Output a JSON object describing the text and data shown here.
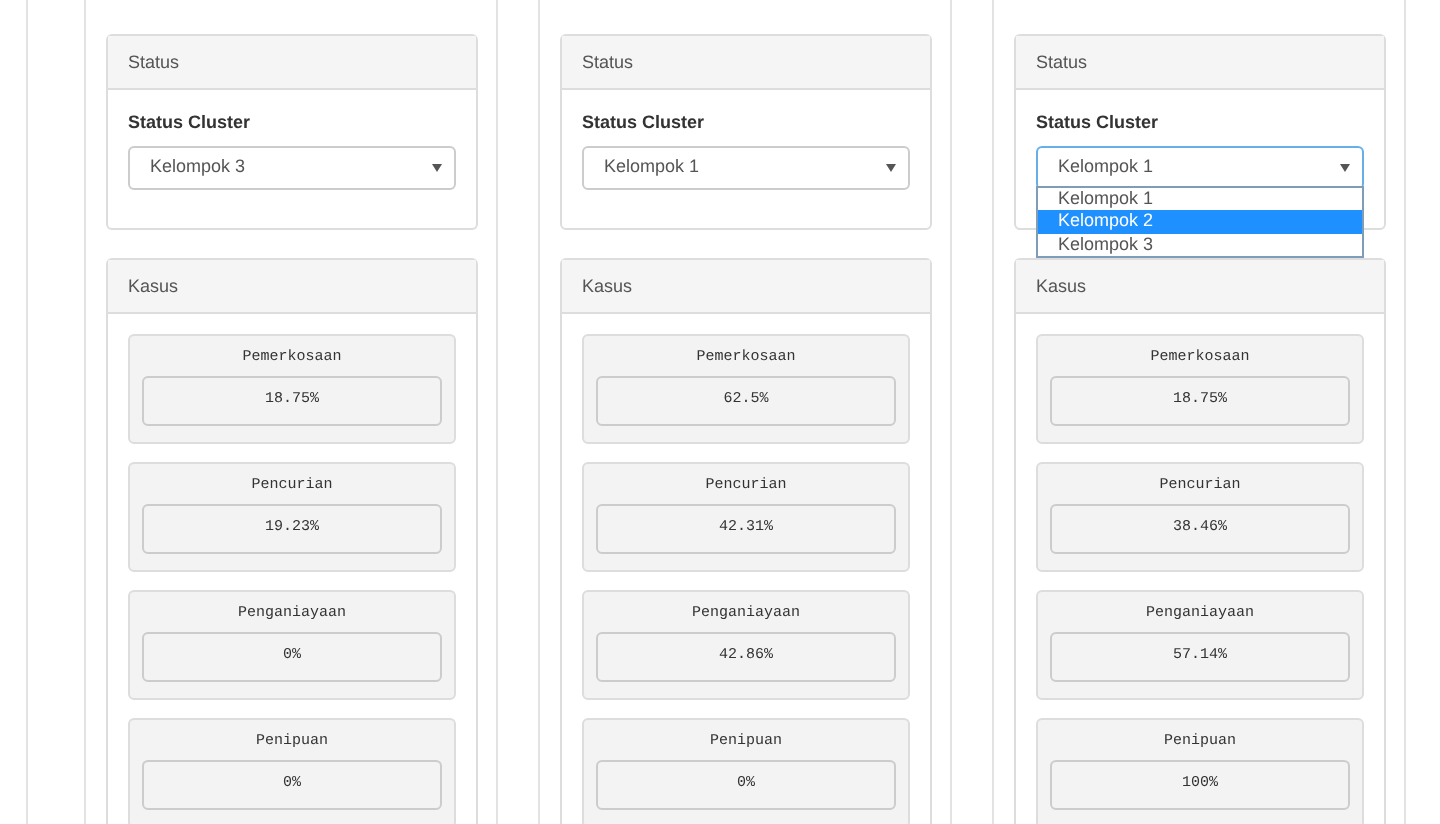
{
  "columns": [
    {
      "status_title": "Status",
      "cluster_label": "Status Cluster",
      "select": {
        "value": "Kelompok 3",
        "open": false
      },
      "cases_title": "Kasus",
      "cases": [
        {
          "label": "Pemerkosaan",
          "value": "18.75%"
        },
        {
          "label": "Pencurian",
          "value": "19.23%"
        },
        {
          "label": "Penganiayaan",
          "value": "0%"
        },
        {
          "label": "Penipuan",
          "value": "0%"
        }
      ]
    },
    {
      "status_title": "Status",
      "cluster_label": "Status Cluster",
      "select": {
        "value": "Kelompok 1",
        "open": false
      },
      "cases_title": "Kasus",
      "cases": [
        {
          "label": "Pemerkosaan",
          "value": "62.5%"
        },
        {
          "label": "Pencurian",
          "value": "42.31%"
        },
        {
          "label": "Penganiayaan",
          "value": "42.86%"
        },
        {
          "label": "Penipuan",
          "value": "0%"
        }
      ]
    },
    {
      "status_title": "Status",
      "cluster_label": "Status Cluster",
      "select": {
        "value": "Kelompok 1",
        "open": true,
        "options": [
          {
            "label": "Kelompok 1",
            "highlighted": false
          },
          {
            "label": "Kelompok 2",
            "highlighted": true
          },
          {
            "label": "Kelompok 3",
            "highlighted": false
          }
        ]
      },
      "cases_title": "Kasus",
      "cases": [
        {
          "label": "Pemerkosaan",
          "value": "18.75%"
        },
        {
          "label": "Pencurian",
          "value": "38.46%"
        },
        {
          "label": "Penganiayaan",
          "value": "57.14%"
        },
        {
          "label": "Penipuan",
          "value": "100%"
        }
      ]
    }
  ]
}
